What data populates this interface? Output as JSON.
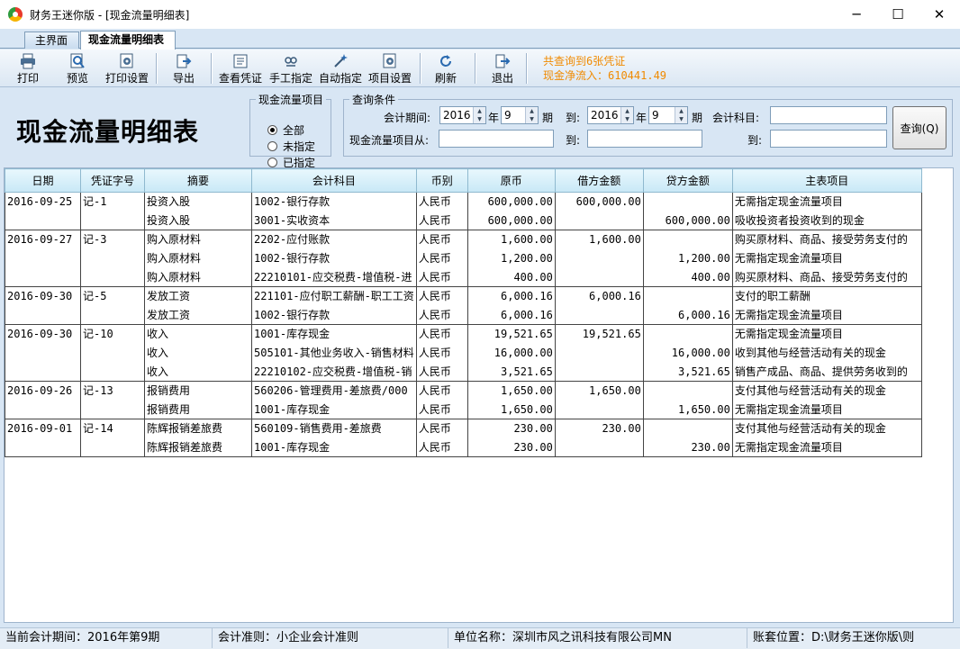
{
  "window": {
    "title": "财务王迷你版 - [现金流量明细表]",
    "controls": {
      "minimize": "─",
      "maximize": "☐",
      "close": "✕"
    }
  },
  "tabs": [
    {
      "label": "主界面",
      "active": false
    },
    {
      "label": "现金流量明细表",
      "active": true
    }
  ],
  "toolbar": {
    "print": "打印",
    "preview": "预览",
    "print_settings": "打印设置",
    "export": "导出",
    "view_voucher": "查看凭证",
    "manual_assign": "手工指定",
    "auto_assign": "自动指定",
    "item_settings": "项目设置",
    "refresh": "刷新",
    "exit": "退出"
  },
  "summary": {
    "line1": "共查询到6张凭证",
    "line2": "现金净流入：610441.49"
  },
  "page_title": "现金流量明细表",
  "cashflow_group": {
    "legend": "现金流量项目",
    "options": [
      {
        "label": "全部",
        "selected": true
      },
      {
        "label": "未指定",
        "selected": false
      },
      {
        "label": "已指定",
        "selected": false
      }
    ]
  },
  "query": {
    "legend": "查询条件",
    "period_label": "会计期间:",
    "year_from": "2016",
    "year_unit": "年",
    "period_from": "9",
    "period_unit": "期",
    "to_label": "到:",
    "year_to": "2016",
    "period_to": "9",
    "account_label": "会计科目:",
    "account_from": "",
    "item_from_label": "现金流量项目从:",
    "item_from": "",
    "item_to": "",
    "account_to": "",
    "button": "查询(Q)"
  },
  "table": {
    "columns": [
      "日期",
      "凭证字号",
      "摘要",
      "会计科目",
      "币别",
      "原币",
      "借方金额",
      "贷方金额",
      "主表项目"
    ],
    "groups": [
      {
        "date": "2016-09-25",
        "voucher": "记-1",
        "rows": [
          [
            "投资入股",
            "1002-银行存款",
            "人民币",
            "600,000.00",
            "600,000.00",
            "",
            "无需指定现金流量项目"
          ],
          [
            "投资入股",
            "3001-实收资本",
            "人民币",
            "600,000.00",
            "",
            "600,000.00",
            "吸收投资者投资收到的现金"
          ]
        ]
      },
      {
        "date": "2016-09-27",
        "voucher": "记-3",
        "rows": [
          [
            "购入原材料",
            "2202-应付账款",
            "人民币",
            "1,600.00",
            "1,600.00",
            "",
            "购买原材料、商品、接受劳务支付的"
          ],
          [
            "购入原材料",
            "1002-银行存款",
            "人民币",
            "1,200.00",
            "",
            "1,200.00",
            "无需指定现金流量项目"
          ],
          [
            "购入原材料",
            "22210101-应交税费-增值税-进",
            "人民币",
            "400.00",
            "",
            "400.00",
            "购买原材料、商品、接受劳务支付的"
          ]
        ]
      },
      {
        "date": "2016-09-30",
        "voucher": "记-5",
        "rows": [
          [
            "发放工资",
            "221101-应付职工薪酬-职工工资",
            "人民币",
            "6,000.16",
            "6,000.16",
            "",
            "支付的职工薪酬"
          ],
          [
            "发放工资",
            "1002-银行存款",
            "人民币",
            "6,000.16",
            "",
            "6,000.16",
            "无需指定现金流量项目"
          ]
        ]
      },
      {
        "date": "2016-09-30",
        "voucher": "记-10",
        "rows": [
          [
            "收入",
            "1001-库存现金",
            "人民币",
            "19,521.65",
            "19,521.65",
            "",
            "无需指定现金流量项目"
          ],
          [
            "收入",
            "505101-其他业务收入-销售材料",
            "人民币",
            "16,000.00",
            "",
            "16,000.00",
            "收到其他与经营活动有关的现金"
          ],
          [
            "收入",
            "22210102-应交税费-增值税-销",
            "人民币",
            "3,521.65",
            "",
            "3,521.65",
            "销售产成品、商品、提供劳务收到的"
          ]
        ]
      },
      {
        "date": "2016-09-26",
        "voucher": "记-13",
        "rows": [
          [
            "报销费用",
            "560206-管理费用-差旅费/000",
            "人民币",
            "1,650.00",
            "1,650.00",
            "",
            "支付其他与经营活动有关的现金"
          ],
          [
            "报销费用",
            "1001-库存现金",
            "人民币",
            "1,650.00",
            "",
            "1,650.00",
            "无需指定现金流量项目"
          ]
        ]
      },
      {
        "date": "2016-09-01",
        "voucher": "记-14",
        "rows": [
          [
            "陈辉报销差旅费",
            "560109-销售费用-差旅费",
            "人民币",
            "230.00",
            "230.00",
            "",
            "支付其他与经营活动有关的现金"
          ],
          [
            "陈辉报销差旅费",
            "1001-库存现金",
            "人民币",
            "230.00",
            "",
            "230.00",
            "无需指定现金流量项目"
          ]
        ]
      }
    ]
  },
  "statusbar": {
    "period": "当前会计期间：2016年第9期",
    "standard": "会计准则：小企业会计准则",
    "company": "单位名称：深圳市风之讯科技有限公司MN",
    "location": "账套位置：D:\\财务王迷你版\\则"
  }
}
